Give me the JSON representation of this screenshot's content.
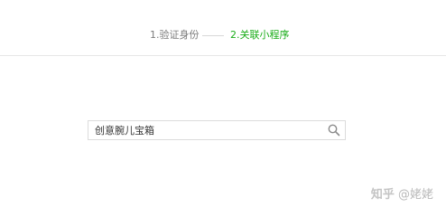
{
  "steps": {
    "step1_label": "1.验证身份",
    "step2_label": "2.关联小程序",
    "active_color": "#1aad19",
    "inactive_color": "#7b7b7b"
  },
  "search": {
    "value": "创意腕儿宝箱",
    "icon": "search-icon"
  },
  "watermark": {
    "brand": "知乎",
    "user": "@姥姥"
  }
}
